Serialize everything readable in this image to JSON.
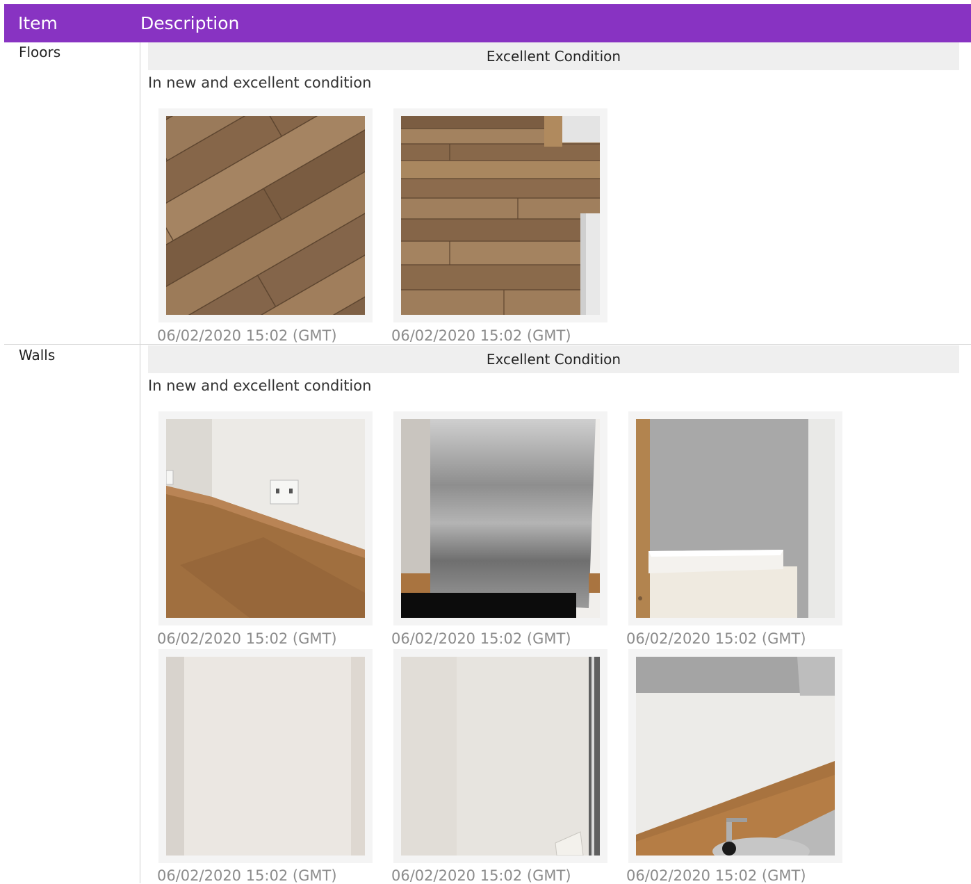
{
  "header": {
    "item_label": "Item",
    "description_label": "Description"
  },
  "colors": {
    "header_bg": "#8833c2",
    "condition_bar_bg": "#efefef",
    "timestamp_text": "#8c8c8c"
  },
  "rows": [
    {
      "item": "Floors",
      "condition": "Excellent Condition",
      "description": "In new and excellent condition",
      "photos": [
        {
          "subject": "wood-laminate-floor-diagonal",
          "timestamp": "06/02/2020 15:02 (GMT)"
        },
        {
          "subject": "wood-laminate-floor-doorway",
          "timestamp": "06/02/2020 15:02 (GMT)"
        }
      ]
    },
    {
      "item": "Walls",
      "condition": "Excellent Condition",
      "description": "In new and excellent condition",
      "photos": [
        {
          "subject": "wall-corner-with-socket",
          "timestamp": "06/02/2020 15:02 (GMT)"
        },
        {
          "subject": "stainless-steel-splashback",
          "timestamp": "06/02/2020 15:02 (GMT)"
        },
        {
          "subject": "grey-wall-with-mantel",
          "timestamp": "06/02/2020 15:02 (GMT)"
        },
        {
          "subject": "plain-white-wall",
          "timestamp": "06/02/2020 15:02 (GMT)"
        },
        {
          "subject": "plain-white-wall-radiator",
          "timestamp": "06/02/2020 15:02 (GMT)"
        },
        {
          "subject": "kitchen-wall-with-sink",
          "timestamp": "06/02/2020 15:02 (GMT)"
        }
      ]
    }
  ]
}
